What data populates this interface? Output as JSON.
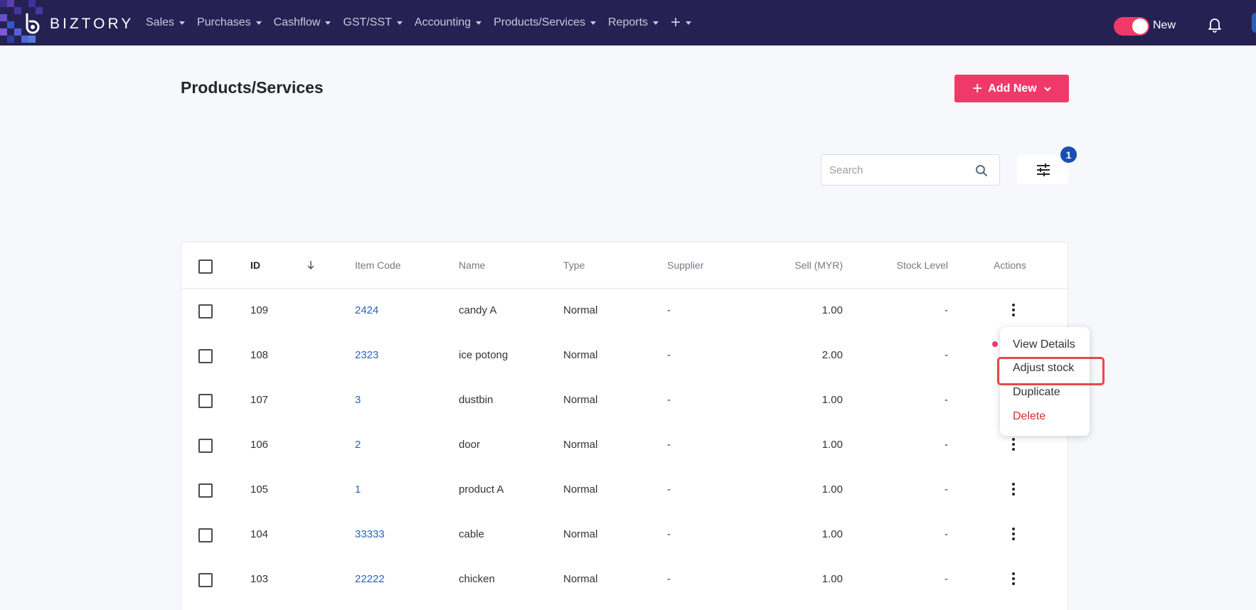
{
  "app": {
    "logo_text": "BIZTORY",
    "brand_color": "#262153",
    "accent_color": "#ef3a69"
  },
  "nav": {
    "items": [
      {
        "label": "Sales"
      },
      {
        "label": "Purchases"
      },
      {
        "label": "Cashflow"
      },
      {
        "label": "GST/SST"
      },
      {
        "label": "Accounting"
      },
      {
        "label": "Products/Services"
      },
      {
        "label": "Reports"
      }
    ],
    "plus_icon": "plus-icon",
    "toggle_label": "New",
    "toggle_on": true,
    "bell_icon": "bell-icon"
  },
  "page": {
    "title": "Products/Services",
    "add_new_label": "Add New"
  },
  "search": {
    "placeholder": "Search"
  },
  "filter": {
    "badge_count": "1"
  },
  "table": {
    "headers": {
      "id": "ID",
      "item_code": "Item Code",
      "name": "Name",
      "type": "Type",
      "supplier": "Supplier",
      "sell": "Sell (MYR)",
      "stock": "Stock Level",
      "actions": "Actions"
    },
    "rows": [
      {
        "id": "109",
        "item_code": "2424",
        "name": "candy A",
        "type": "Normal",
        "supplier": "-",
        "sell": "1.00",
        "stock": "-"
      },
      {
        "id": "108",
        "item_code": "2323",
        "name": "ice potong",
        "type": "Normal",
        "supplier": "-",
        "sell": "2.00",
        "stock": "-"
      },
      {
        "id": "107",
        "item_code": "3",
        "name": "dustbin",
        "type": "Normal",
        "supplier": "-",
        "sell": "1.00",
        "stock": "-"
      },
      {
        "id": "106",
        "item_code": "2",
        "name": "door",
        "type": "Normal",
        "supplier": "-",
        "sell": "1.00",
        "stock": "-"
      },
      {
        "id": "105",
        "item_code": "1",
        "name": "product A",
        "type": "Normal",
        "supplier": "-",
        "sell": "1.00",
        "stock": "-"
      },
      {
        "id": "104",
        "item_code": "33333",
        "name": "cable",
        "type": "Normal",
        "supplier": "-",
        "sell": "1.00",
        "stock": "-"
      },
      {
        "id": "103",
        "item_code": "22222",
        "name": "chicken",
        "type": "Normal",
        "supplier": "-",
        "sell": "1.00",
        "stock": "-"
      }
    ]
  },
  "action_menu": {
    "items": [
      {
        "label": "View Details"
      },
      {
        "label": "Adjust stock"
      },
      {
        "label": "Duplicate"
      },
      {
        "label": "Delete"
      }
    ]
  }
}
